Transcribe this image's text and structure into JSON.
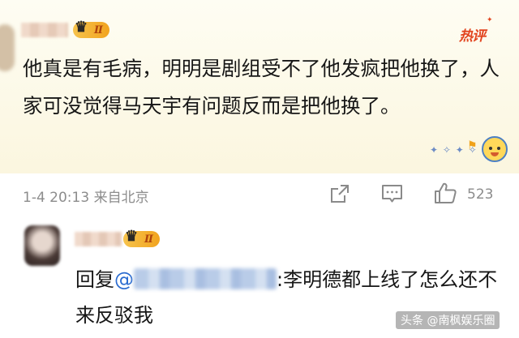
{
  "comment": {
    "badge_level": "Ⅱ",
    "hot_label": "热评",
    "text": "他真是有毛病，明明是剧组受不了他发疯把他换了，人家可没觉得马天宇有问题反而是把他换了。",
    "time": "1-4 20:13",
    "source": "来自北京",
    "like_count": "523"
  },
  "reply": {
    "badge_level": "Ⅱ",
    "prefix": "回复",
    "mention_at": "@",
    "text": ":李明德都上线了怎么还不来反驳我"
  },
  "watermark": "头条 @南枫娱乐圈",
  "colors": {
    "card_bg": "#fbf6df",
    "hot": "#e2441f",
    "badge": "#f2a41f",
    "mention": "#2a6bd0",
    "meta": "#8c8c8c"
  },
  "icons": [
    "share-icon",
    "comment-icon",
    "like-icon",
    "crown-icon"
  ]
}
